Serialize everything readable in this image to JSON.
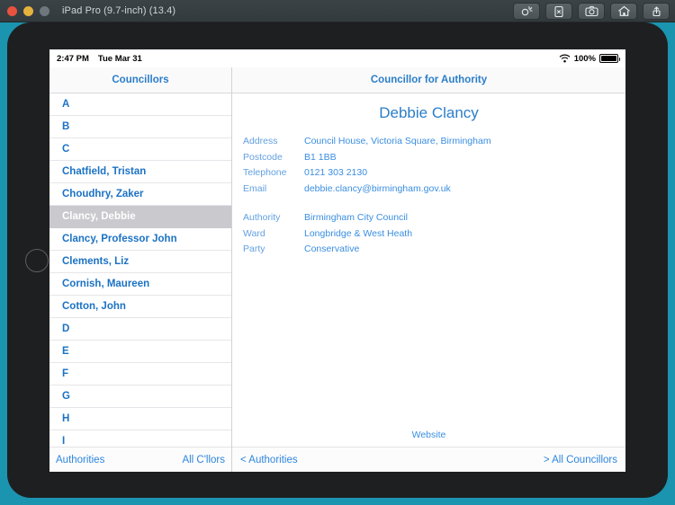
{
  "window": {
    "title": "iPad Pro (9.7-inch) (13.4)",
    "traffic_lights": [
      "close-red",
      "minimize-yellow",
      "zoom-gray"
    ],
    "toolbar_buttons": [
      {
        "name": "siri-icon",
        "label": "Siri"
      },
      {
        "name": "rotate-device-icon",
        "label": "Rotate"
      },
      {
        "name": "screenshot-camera-icon",
        "label": "Screenshot"
      },
      {
        "name": "home-icon",
        "label": "Home"
      },
      {
        "name": "share-export-icon",
        "label": "Share"
      }
    ]
  },
  "status_bar": {
    "time": "2:47 PM",
    "date": "Tue Mar 31",
    "wifi_icon": "wifi-icon",
    "battery_percent": "100%"
  },
  "master": {
    "nav_title": "Councillors",
    "rows": [
      {
        "label": "A",
        "selected": false
      },
      {
        "label": "B",
        "selected": false
      },
      {
        "label": "C",
        "selected": false
      },
      {
        "label": "Chatfield, Tristan",
        "selected": false
      },
      {
        "label": "Choudhry, Zaker",
        "selected": false
      },
      {
        "label": "Clancy, Debbie",
        "selected": true
      },
      {
        "label": "Clancy, Professor John",
        "selected": false
      },
      {
        "label": "Clements, Liz",
        "selected": false
      },
      {
        "label": "Cornish, Maureen",
        "selected": false
      },
      {
        "label": "Cotton, John",
        "selected": false
      },
      {
        "label": "D",
        "selected": false
      },
      {
        "label": "E",
        "selected": false
      },
      {
        "label": "F",
        "selected": false
      },
      {
        "label": "G",
        "selected": false
      },
      {
        "label": "H",
        "selected": false
      },
      {
        "label": "I",
        "selected": false
      }
    ],
    "toolbar": {
      "left_label": "Authorities",
      "right_label": "All C'llors"
    }
  },
  "detail": {
    "nav_title": "Councillor for Authority",
    "person_name": "Debbie Clancy",
    "fields_group_1": [
      {
        "label": "Address",
        "value": "Council House, Victoria Square, Birmingham"
      },
      {
        "label": "Postcode",
        "value": "B1 1BB"
      },
      {
        "label": "Telephone",
        "value": "0121 303 2130"
      },
      {
        "label": "Email",
        "value": "debbie.clancy@birmingham.gov.uk"
      }
    ],
    "fields_group_2": [
      {
        "label": "Authority",
        "value": "Birmingham City Council"
      },
      {
        "label": "Ward",
        "value": "Longbridge & West Heath"
      },
      {
        "label": "Party",
        "value": "Conservative"
      }
    ],
    "website_link": "Website",
    "toolbar": {
      "left_label": "< Authorities",
      "right_label": "> All Councillors"
    }
  },
  "colors": {
    "accent_blue": "#2b7ec9",
    "link_blue": "#3a8ee0",
    "label_blue": "#63a0e0",
    "selected_row_bg": "#c9c9ce",
    "backdrop_teal": "#1b94b0",
    "device_body": "#1e1f21"
  }
}
